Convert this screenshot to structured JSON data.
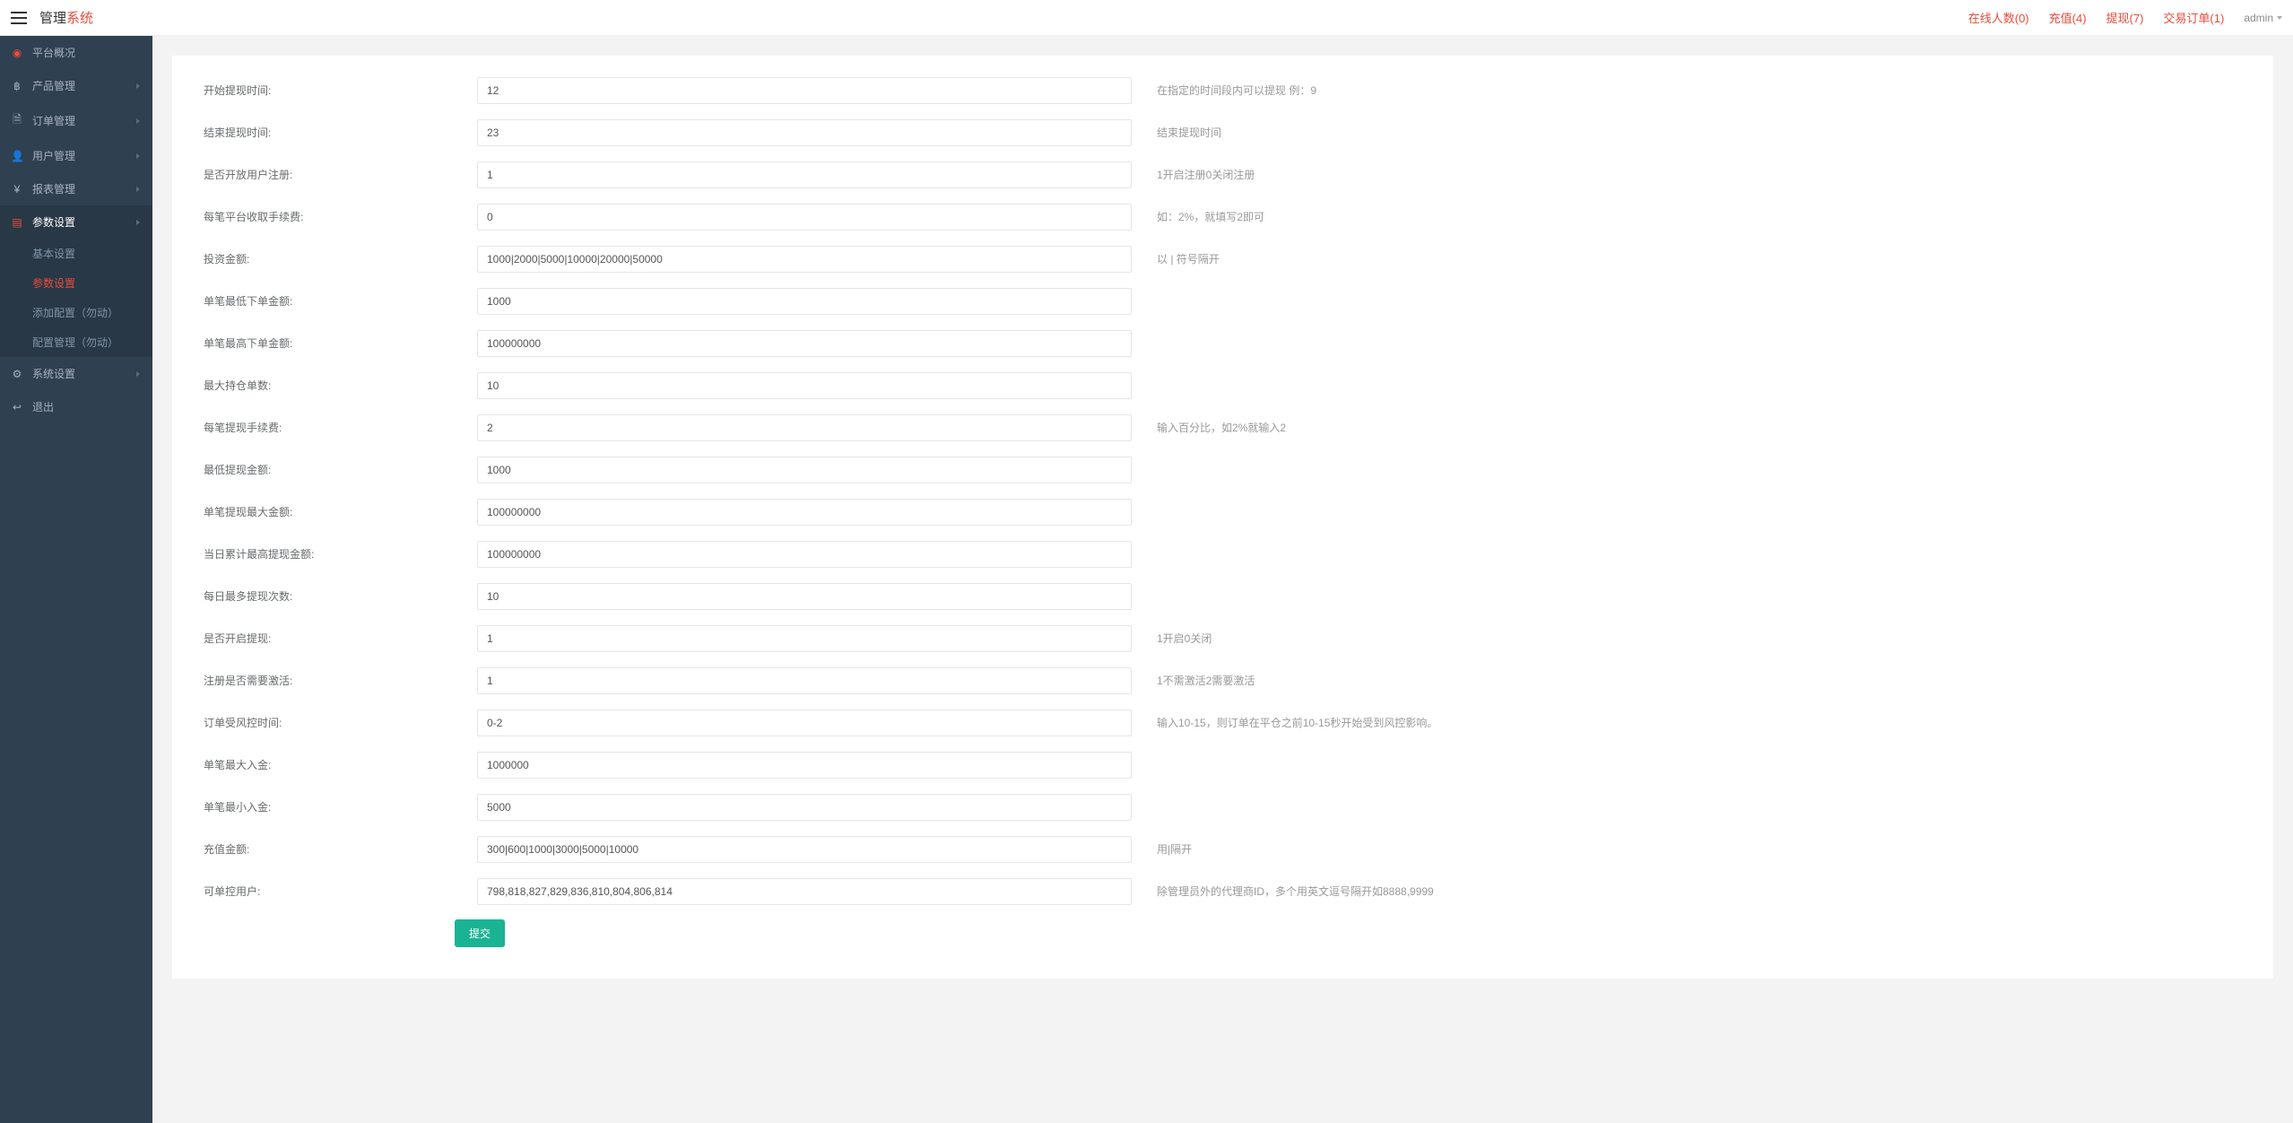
{
  "header": {
    "logo1": "管理",
    "logo2": "系统",
    "stats": {
      "online": "在线人数(0)",
      "recharge": "充值(4)",
      "withdraw": "提现(7)",
      "orders": "交易订单(1)"
    },
    "user": "admin"
  },
  "sidebar": {
    "items": [
      {
        "icon": "dashboard",
        "iconRed": true,
        "label": "平台概况",
        "hasArrow": false
      },
      {
        "icon": "bitcoin",
        "iconRed": false,
        "label": "产品管理",
        "hasArrow": true
      },
      {
        "icon": "file",
        "iconRed": false,
        "label": "订单管理",
        "hasArrow": true
      },
      {
        "icon": "user",
        "iconRed": false,
        "label": "用户管理",
        "hasArrow": true
      },
      {
        "icon": "yen",
        "iconRed": false,
        "label": "报表管理",
        "hasArrow": true
      },
      {
        "icon": "params",
        "iconRed": true,
        "label": "参数设置",
        "hasArrow": true,
        "selected": true
      },
      {
        "icon": "cog",
        "iconRed": false,
        "label": "系统设置",
        "hasArrow": true
      },
      {
        "icon": "exit",
        "iconRed": false,
        "label": "退出",
        "hasArrow": false
      }
    ],
    "sub": [
      {
        "label": "基本设置",
        "active": false
      },
      {
        "label": "参数设置",
        "active": true
      },
      {
        "label": "添加配置（勿动）",
        "active": false
      },
      {
        "label": "配置管理（勿动）",
        "active": false
      }
    ]
  },
  "form": {
    "rows": [
      {
        "label": "开始提现时间:",
        "value": "12",
        "hint": "在指定的时间段内可以提现 例：9"
      },
      {
        "label": "结束提现时间:",
        "value": "23",
        "hint": "结束提现时间"
      },
      {
        "label": "是否开放用户注册:",
        "value": "1",
        "hint": "1开启注册0关闭注册"
      },
      {
        "label": "每笔平台收取手续费:",
        "value": "0",
        "hint": "如：2%，就填写2即可"
      },
      {
        "label": "投资金额:",
        "value": "1000|2000|5000|10000|20000|50000",
        "hint": "以 | 符号隔开"
      },
      {
        "label": "单笔最低下单金额:",
        "value": "1000",
        "hint": ""
      },
      {
        "label": "单笔最高下单金额:",
        "value": "100000000",
        "hint": ""
      },
      {
        "label": "最大持仓单数:",
        "value": "10",
        "hint": ""
      },
      {
        "label": "每笔提现手续费:",
        "value": "2",
        "hint": "输入百分比，如2%就输入2"
      },
      {
        "label": "最低提现金额:",
        "value": "1000",
        "hint": ""
      },
      {
        "label": "单笔提现最大金额:",
        "value": "100000000",
        "hint": ""
      },
      {
        "label": "当日累计最高提现金额:",
        "value": "100000000",
        "hint": ""
      },
      {
        "label": "每日最多提现次数:",
        "value": "10",
        "hint": ""
      },
      {
        "label": "是否开启提现:",
        "value": "1",
        "hint": "1开启0关闭"
      },
      {
        "label": "注册是否需要激活:",
        "value": "1",
        "hint": "1不需激活2需要激活"
      },
      {
        "label": "订单受风控时间:",
        "value": "0-2",
        "hint": "输入10-15，则订单在平仓之前10-15秒开始受到风控影响。"
      },
      {
        "label": "单笔最大入金:",
        "value": "1000000",
        "hint": ""
      },
      {
        "label": "单笔最小入金:",
        "value": "5000",
        "hint": ""
      },
      {
        "label": "充值金额:",
        "value": "300|600|1000|3000|5000|10000",
        "hint": "用|隔开"
      },
      {
        "label": "可单控用户:",
        "value": "798,818,827,829,836,810,804,806,814",
        "hint": "除管理员外的代理商ID，多个用英文逗号隔开如8888,9999"
      }
    ],
    "submit": "提交"
  },
  "icons": {
    "dashboard": "◉",
    "bitcoin": "฿",
    "file": "🗎",
    "user": "👤",
    "yen": "¥",
    "params": "▤",
    "cog": "⚙",
    "exit": "↩"
  }
}
